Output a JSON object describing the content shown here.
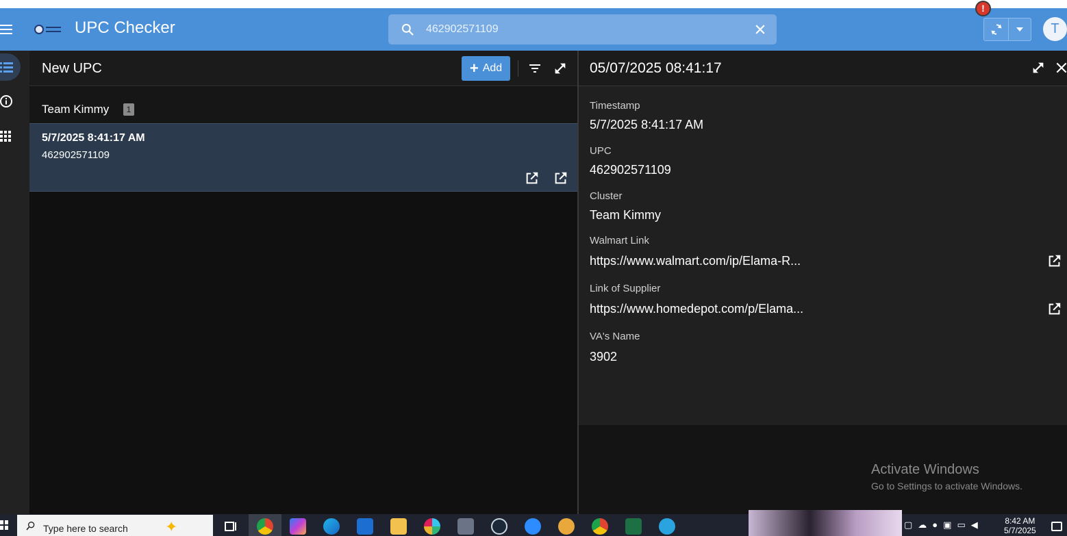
{
  "header": {
    "app_title": "UPC Checker",
    "search": {
      "value": "462902571109"
    },
    "alert_badge": "!",
    "avatar_initial": "T"
  },
  "left_panel": {
    "title": "New UPC",
    "add_label": "Add",
    "group": {
      "name": "Team Kimmy",
      "count": "1"
    },
    "rows": [
      {
        "time": "5/7/2025 8:41:17 AM",
        "upc": "462902571109"
      }
    ]
  },
  "detail": {
    "title": "05/07/2025 08:41:17",
    "fields": [
      {
        "label": "Timestamp",
        "value": "5/7/2025 8:41:17 AM"
      },
      {
        "label": "UPC",
        "value": "462902571109"
      },
      {
        "label": "Cluster",
        "value": "Team Kimmy"
      },
      {
        "label": "Walmart Link",
        "value": "https://www.walmart.com/ip/Elama-R..."
      },
      {
        "label": "Link of Supplier",
        "value": "https://www.homedepot.com/p/Elama..."
      },
      {
        "label": "VA's Name",
        "value": "3902"
      }
    ],
    "watermark": {
      "line1": "Activate Windows",
      "line2": "Go to Settings to activate Windows."
    }
  },
  "taskbar": {
    "search_placeholder": "Type here to search",
    "time": "8:42 AM",
    "date": "5/7/2025"
  },
  "colors": {
    "brand_blue": "#4a90d9",
    "selected_row": "#2b3a4d",
    "alert_red": "#d8372c"
  }
}
